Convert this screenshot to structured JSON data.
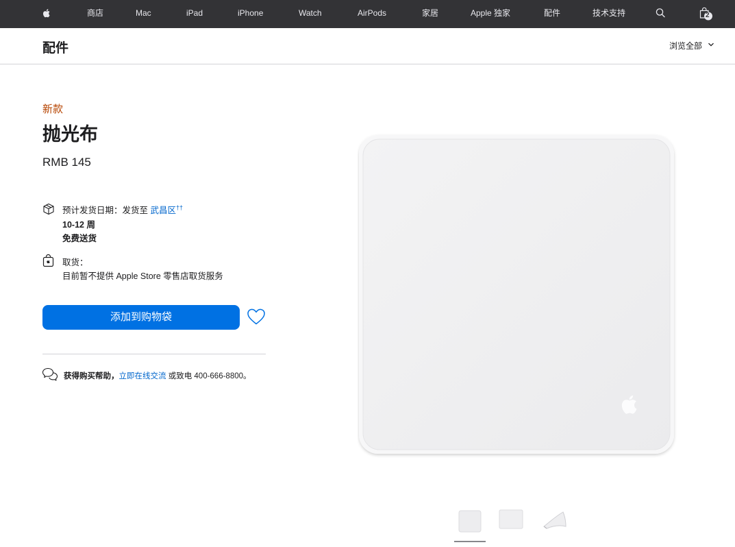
{
  "global_nav": {
    "items": [
      {
        "key": "store",
        "label": "商店"
      },
      {
        "key": "mac",
        "label": "Mac"
      },
      {
        "key": "ipad",
        "label": "iPad"
      },
      {
        "key": "iphone",
        "label": "iPhone"
      },
      {
        "key": "watch",
        "label": "Watch"
      },
      {
        "key": "airpods",
        "label": "AirPods"
      },
      {
        "key": "home",
        "label": "家居"
      },
      {
        "key": "exclusive",
        "label": "Apple 独家"
      },
      {
        "key": "accessories",
        "label": "配件"
      },
      {
        "key": "support",
        "label": "技术支持"
      }
    ],
    "bag_count": "2",
    "icons": [
      "apple-logo-icon",
      "search-icon",
      "shopping-bag-icon"
    ]
  },
  "local_nav": {
    "title": "配件",
    "browse_label": "浏览全部"
  },
  "product": {
    "badge": "新款",
    "name": "抛光布",
    "price": "RMB 145"
  },
  "delivery": {
    "label": "预计发货日期：发货至",
    "location": "武昌区",
    "footnote": "††",
    "lead_time": "10-12 周",
    "shipping": "免费送货"
  },
  "pickup": {
    "label": "取货：",
    "status": "目前暂不提供 Apple Store 零售店取货服务"
  },
  "actions": {
    "add_to_bag": "添加到购物袋"
  },
  "help": {
    "prefix": "获得购买帮助，",
    "chat_link": "立即在线交流",
    "phone_text": "或致电 400-666-8800。"
  },
  "gallery": {
    "thumbnail_count": 3,
    "selected_index": 0
  },
  "colors": {
    "nav_bg": "#333336",
    "badge": "#b64400",
    "link": "#0066cc",
    "button": "#0071e3"
  }
}
